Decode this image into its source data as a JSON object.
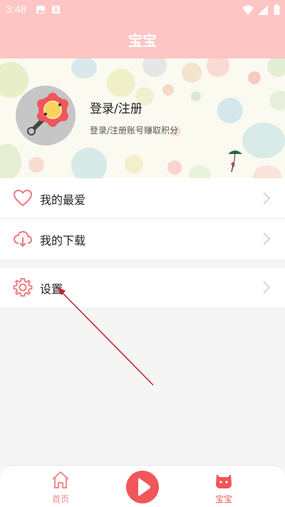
{
  "status_bar": {
    "time": "3:48"
  },
  "header": {
    "title": "宝宝"
  },
  "profile": {
    "login_title": "登录/注册",
    "login_subtitle": "登录/注册账号赚取积分"
  },
  "menu": {
    "favorites": "我的最爱",
    "downloads": "我的下载",
    "settings": "设置"
  },
  "tab_bar": {
    "home": "首页",
    "baby": "宝宝"
  },
  "colors": {
    "header_bg": "#fdc5c3",
    "accent": "#f0565a",
    "icon_pink": "#f07678",
    "active_tab": "#f0565a",
    "inactive_tab": "#f08a8c"
  }
}
